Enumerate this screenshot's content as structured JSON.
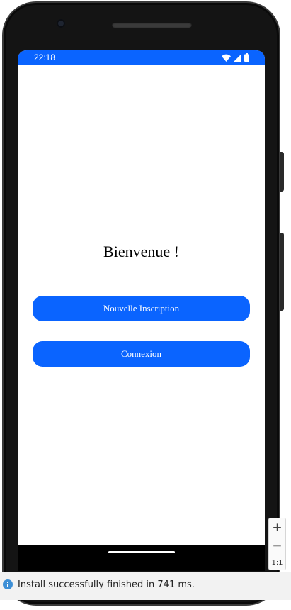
{
  "status_bar": {
    "time": "22:18",
    "icons": [
      "wifi-icon",
      "cell-signal-icon",
      "battery-icon"
    ],
    "background": "#0a64ff"
  },
  "main": {
    "welcome_title": "Bienvenue !",
    "register_button_label": "Nouvelle Inscription",
    "login_button_label": "Connexion",
    "accent_color": "#0a64ff"
  },
  "zoom_controls": {
    "zoom_in_label": "+",
    "zoom_out_label": "−",
    "actual_size_label": "1:1"
  },
  "notification": {
    "icon": "info-icon",
    "message": "Install successfully finished in 741 ms."
  }
}
